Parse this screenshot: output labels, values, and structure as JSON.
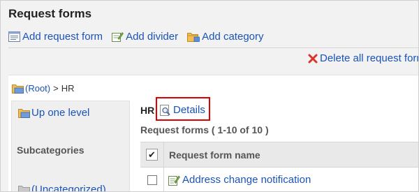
{
  "page": {
    "title": "Request forms"
  },
  "toolbar": {
    "add_form": "Add request form",
    "add_divider": "Add divider",
    "add_category": "Add category",
    "delete_all": "Delete all request forms"
  },
  "breadcrumb": {
    "root": "(Root)",
    "separator": ">",
    "current": "HR"
  },
  "left_panel": {
    "up_level": "Up one level",
    "subcategories_heading": "Subcategories",
    "items": [
      {
        "label": "(Uncategorized)"
      }
    ]
  },
  "category": {
    "name": "HR",
    "details_label": "Details"
  },
  "list": {
    "count_label": "Request forms ( 1-10 of 10 )",
    "check_mark": "✔",
    "column_header": "Request form name",
    "rows": [
      {
        "name": "Address change notification"
      }
    ]
  },
  "colors": {
    "link": "#1a53b8",
    "highlight_border": "#e00000"
  }
}
